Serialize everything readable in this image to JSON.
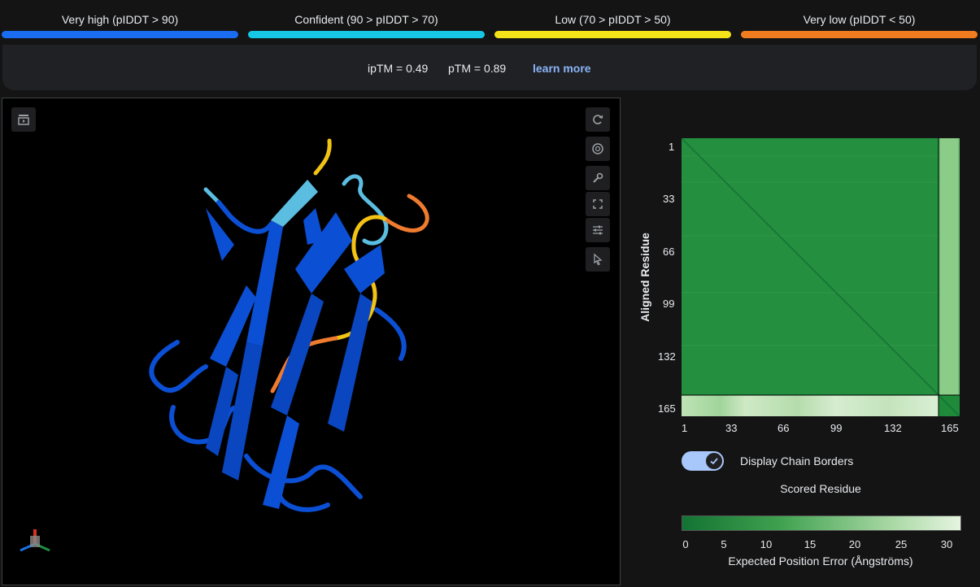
{
  "legend": [
    {
      "label": "Very high (pIDDT > 90)",
      "color": "#1a6cf0"
    },
    {
      "label": "Confident (90 > pIDDT > 70)",
      "color": "#16c8e6"
    },
    {
      "label": "Low (70 > pIDDT > 50)",
      "color": "#f5e31a"
    },
    {
      "label": "Very low (pIDDT < 50)",
      "color": "#f07c1f"
    }
  ],
  "scores": {
    "iptm": "ipTM = 0.49",
    "ptm": "pTM = 0.89",
    "learn_more": "learn more"
  },
  "viewer": {
    "toolbar_icons": [
      "rotate-icon",
      "camera-icon",
      "wrench-icon",
      "expand-icon",
      "sliders-icon",
      "cursor-icon"
    ],
    "left_icon": "play-panel-icon",
    "structure_colors": {
      "very_high": "#0b4fd4",
      "confident": "#5bbde0",
      "low": "#f2c214",
      "very_low": "#ee7b2e"
    }
  },
  "pae": {
    "y_axis_label": "Aligned Residue",
    "x_axis_label": "Scored Residue",
    "ticks": [
      "1",
      "33",
      "66",
      "99",
      "132",
      "165"
    ],
    "chain_border_at": 157,
    "n_residues": 170
  },
  "toggle": {
    "label": "Display Chain Borders",
    "on": true
  },
  "colorbar": {
    "title": "Expected Position Error (Ångströms)",
    "ticks": [
      "0",
      "5",
      "10",
      "15",
      "20",
      "25",
      "30"
    ],
    "colors": [
      "#137333",
      "#3fa14f",
      "#a8d8a4",
      "#e6f4e0"
    ]
  }
}
